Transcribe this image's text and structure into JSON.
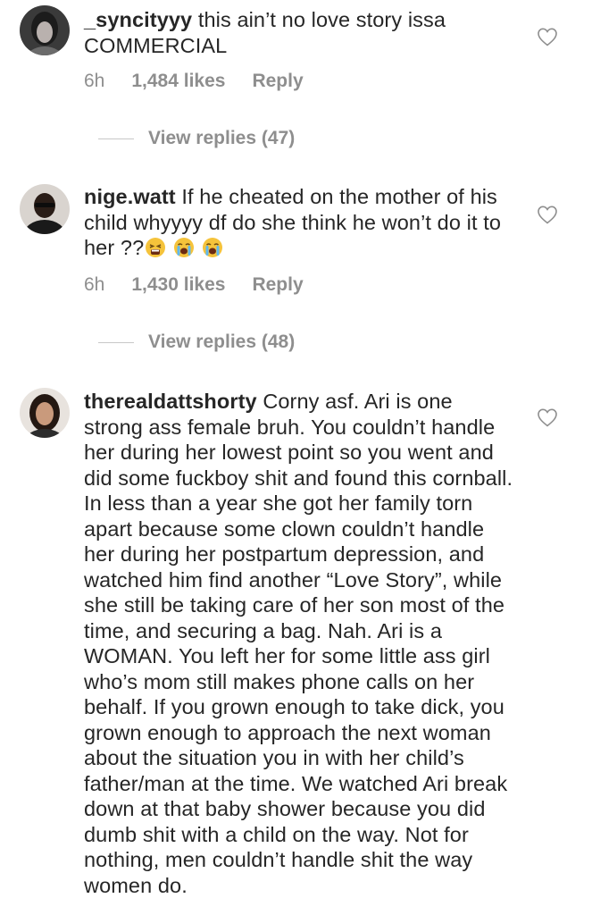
{
  "comments": [
    {
      "username": "_syncityyy",
      "text": "this ain’t no love story issa COMMERCIAL",
      "time": "6h",
      "likes": "1,484 likes",
      "reply_label": "Reply",
      "view_replies": "View replies (47)"
    },
    {
      "username": "nige.watt",
      "text": "If he cheated on the mother of his child whyyyy df do she think he won’t do it to her ??",
      "emojis": [
        "tired-face-emoji",
        "sob-emoji",
        "sob-emoji"
      ],
      "time": "6h",
      "likes": "1,430 likes",
      "reply_label": "Reply",
      "view_replies": "View replies (48)"
    },
    {
      "username": "therealdattshorty",
      "text": "Corny asf. Ari is one strong ass female bruh. You couldn’t handle her during her lowest point so you went and did some fuckboy shit and found this cornball. In less than a year she got her family torn apart because some clown couldn’t handle her during her postpartum depression, and watched him find another “Love Story”, while she still be taking care of her son most of the time, and securing a bag. Nah. Ari is a WOMAN. You left her for some little ass girl who’s mom still makes phone calls on her behalf. If you grown enough to take dick, you grown enough to approach the next woman about the situation you in with her child’s father/man at the time. We watched Ari break down at that baby shower because you did dumb shit with a child on the way. Not for nothing, men couldn’t handle shit the way women do."
    }
  ],
  "icons": {
    "like": "heart-outline-icon"
  },
  "colors": {
    "text": "#262626",
    "meta": "#8e8e8e",
    "divider": "#c7c7c7"
  }
}
